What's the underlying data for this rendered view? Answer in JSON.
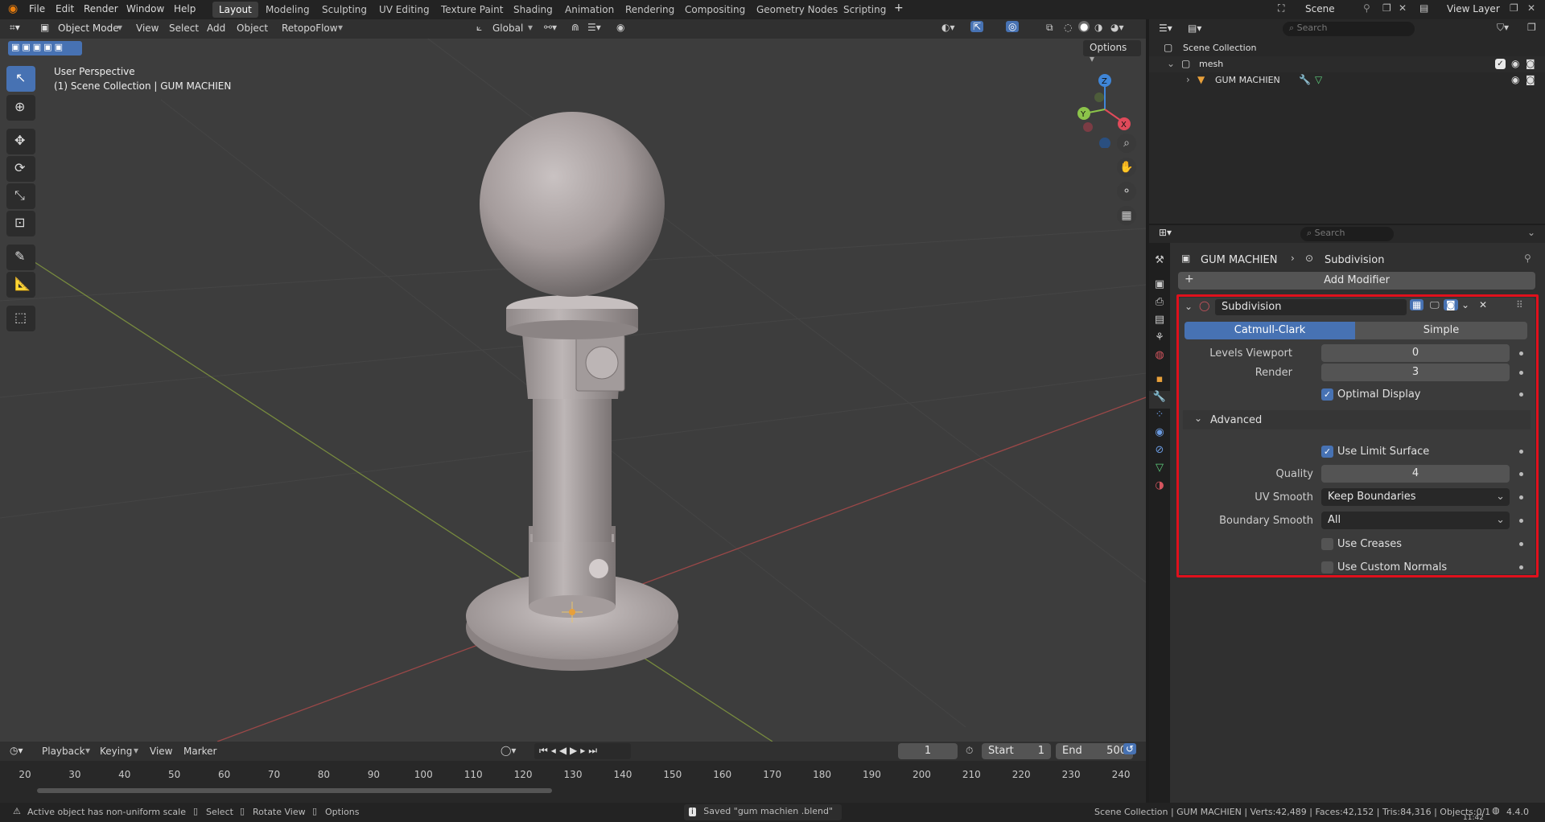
{
  "menubar": {
    "items": [
      "File",
      "Edit",
      "Render",
      "Window",
      "Help"
    ],
    "workspaces": [
      "Layout",
      "Modeling",
      "Sculpting",
      "UV Editing",
      "Texture Paint",
      "Shading",
      "Animation",
      "Rendering",
      "Compositing",
      "Geometry Nodes",
      "Scripting"
    ],
    "add_workspace": "+",
    "scene_label": "Scene",
    "view_layer_label": "View Layer"
  },
  "viewport_header": {
    "mode": "Object Mode",
    "menus": [
      "View",
      "Select",
      "Add",
      "Object"
    ],
    "addon_menu": "RetopoFlow",
    "transform_orientation": "Global",
    "options": "Options"
  },
  "viewport": {
    "perspective": "User Perspective",
    "collection_info": "(1) Scene Collection | GUM MACHIEN",
    "gizmo_axes": [
      "X",
      "Y",
      "Z"
    ],
    "object_name": "GUM MACHIEN"
  },
  "outliner": {
    "search_placeholder": "Search",
    "root": "Scene Collection",
    "collection": "mesh",
    "object": "GUM MACHIEN"
  },
  "properties": {
    "search_placeholder": "Search",
    "breadcrumb_object": "GUM MACHIEN",
    "breadcrumb_modifier": "Subdivision",
    "add_modifier": "Add Modifier",
    "modifier": {
      "name": "Subdivision",
      "algorithms": [
        "Catmull-Clark",
        "Simple"
      ],
      "active_algorithm": "Catmull-Clark",
      "levels_viewport_label": "Levels Viewport",
      "levels_viewport": "0",
      "render_label": "Render",
      "render": "3",
      "optimal_display_label": "Optimal Display",
      "optimal_display": true,
      "advanced_label": "Advanced",
      "use_limit_surface_label": "Use Limit Surface",
      "use_limit_surface": true,
      "quality_label": "Quality",
      "quality": "4",
      "uv_smooth_label": "UV Smooth",
      "uv_smooth": "Keep Boundaries",
      "boundary_smooth_label": "Boundary Smooth",
      "boundary_smooth": "All",
      "use_creases_label": "Use Creases",
      "use_creases": false,
      "use_custom_normals_label": "Use Custom Normals",
      "use_custom_normals": false
    },
    "highlight_color": "#e0101c"
  },
  "timeline": {
    "menus": [
      "Playback",
      "Keying",
      "View",
      "Marker"
    ],
    "current_frame": "1",
    "start_label": "Start",
    "start": "1",
    "end_label": "End",
    "end": "500",
    "ruler": [
      "20",
      "30",
      "40",
      "50",
      "60",
      "70",
      "80",
      "90",
      "100",
      "110",
      "120",
      "130",
      "140",
      "150",
      "160",
      "170",
      "180",
      "190",
      "200",
      "210",
      "220",
      "230",
      "240"
    ],
    "ruler_min": 15,
    "ruler_max": 245
  },
  "statusbar": {
    "warning": "Active object has non-uniform scale",
    "select": "Select",
    "rotate_view": "Rotate View",
    "options": "Options",
    "saved": "Saved \"gum machien .blend\"",
    "stats": "Scene Collection | GUM MACHIEN | Verts:42,489 | Faces:42,152 | Tris:84,316 | Objects:0/1",
    "version": "4.4.0",
    "clock": "11:42"
  },
  "colors": {
    "accent": "#4772b3",
    "viewport_bg": "#3d3d3d",
    "x_axis": "#e04a5a",
    "y_axis": "#8cc44a",
    "z_axis": "#3f86d9"
  }
}
